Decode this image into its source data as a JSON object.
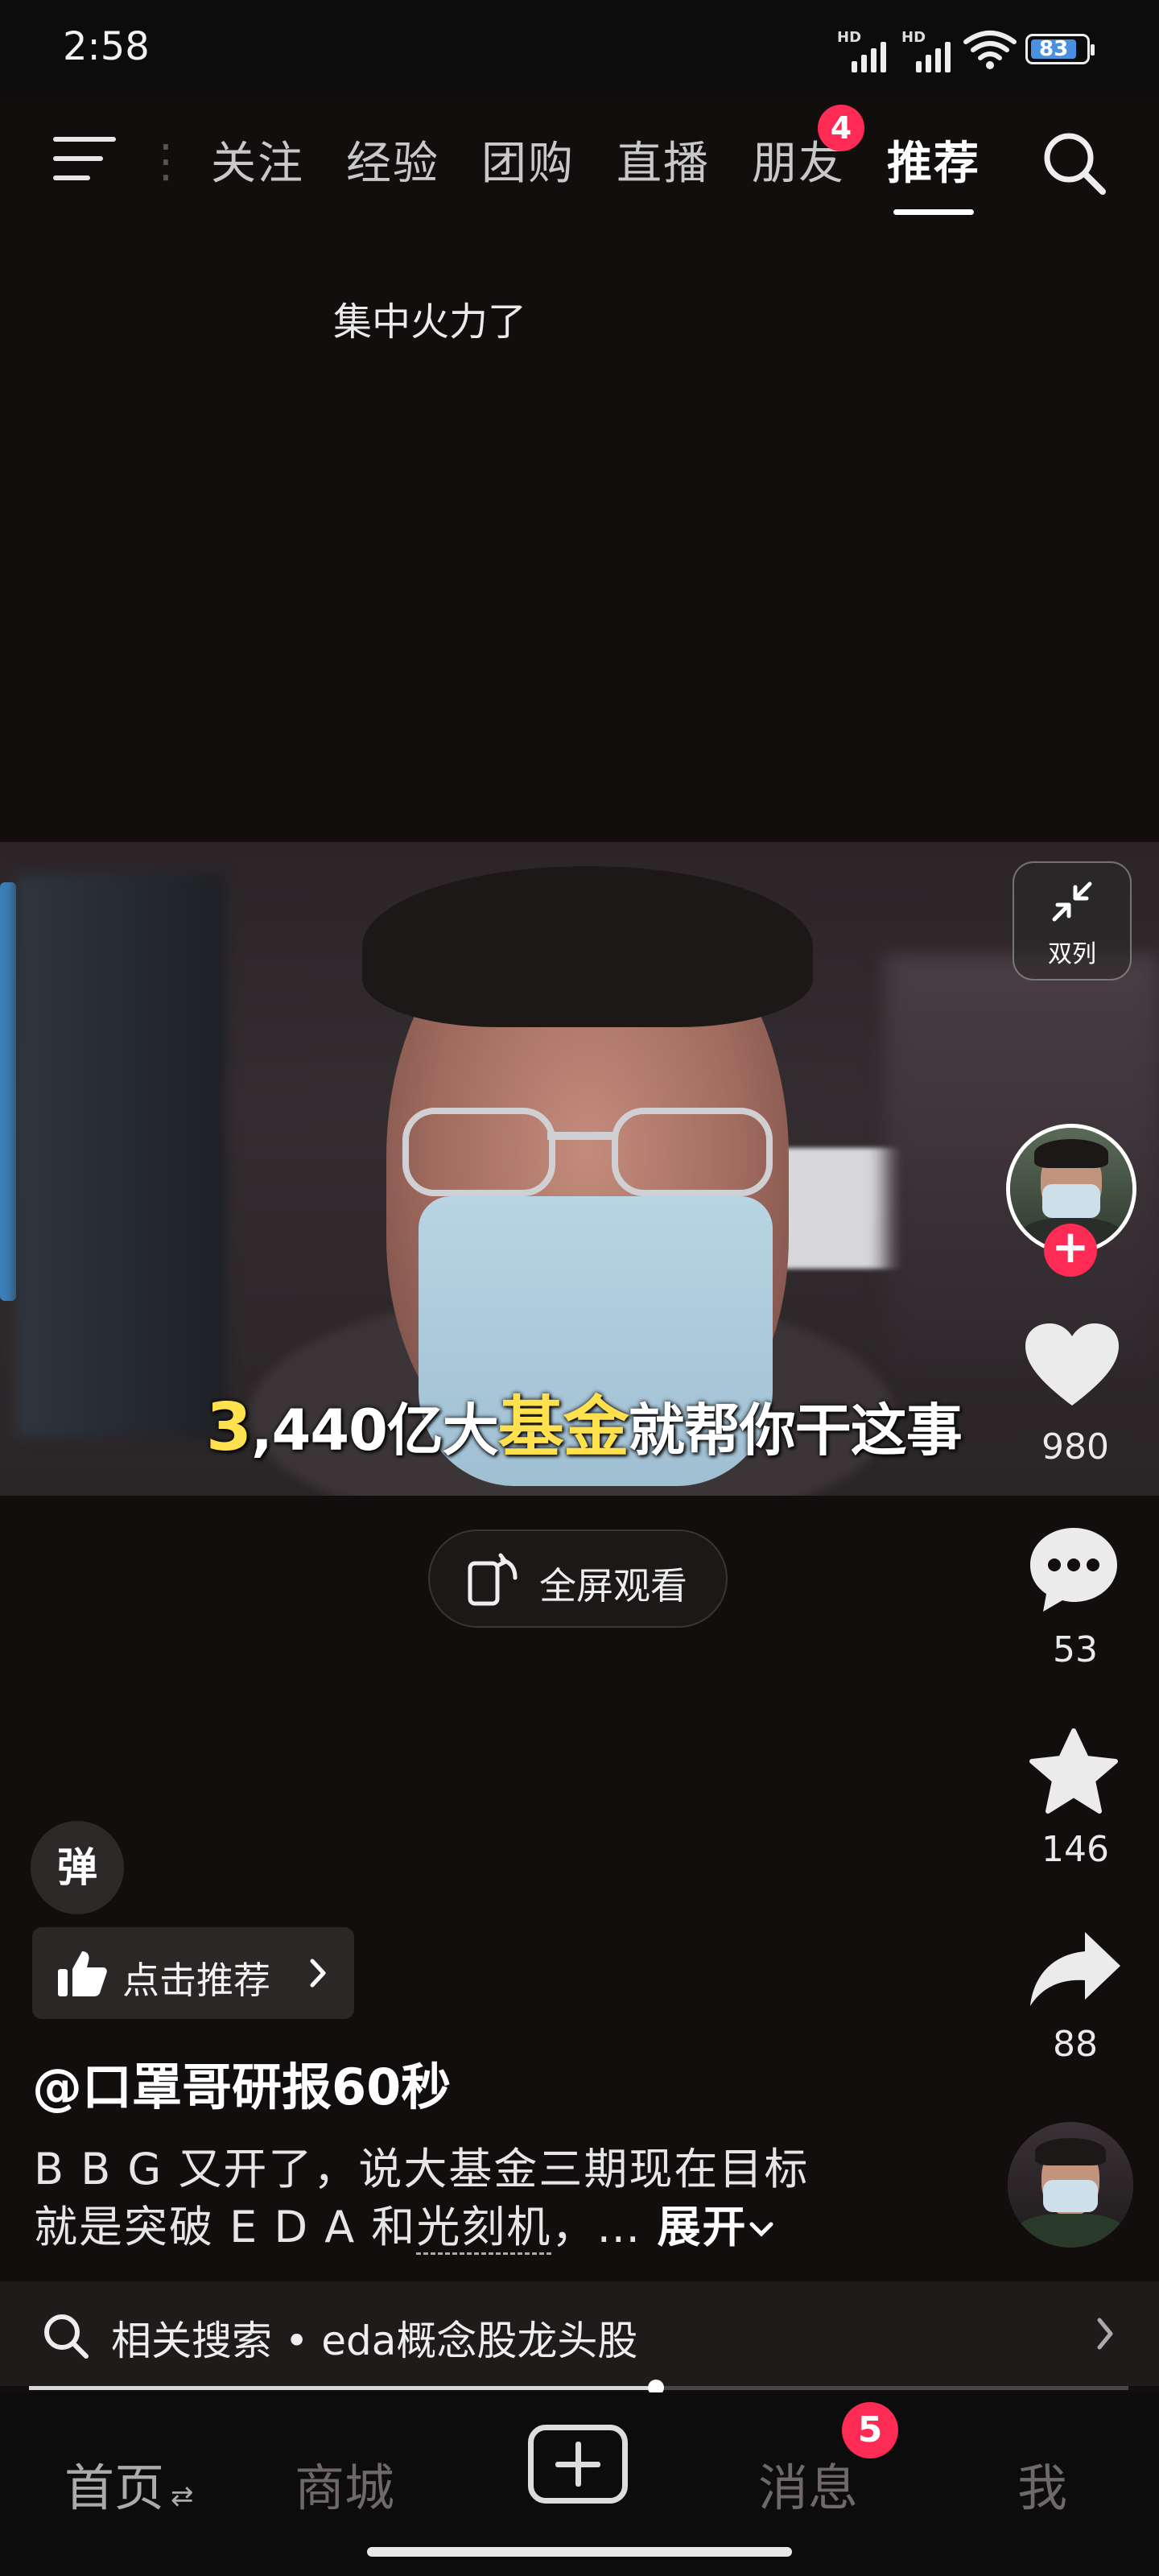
{
  "status_bar": {
    "time": "2:58",
    "battery": "83",
    "signal_label": "HD"
  },
  "top_nav": {
    "tabs": [
      {
        "label": "关注",
        "active": false
      },
      {
        "label": "经验",
        "active": false
      },
      {
        "label": "团购",
        "active": false
      },
      {
        "label": "直播",
        "active": false
      },
      {
        "label": "朋友",
        "active": false
      },
      {
        "label": "推荐",
        "active": true
      }
    ],
    "friends_badge": "4"
  },
  "caption": "集中火力了",
  "video": {
    "subtitle_part1": "3",
    "subtitle_part2": ",440亿大",
    "subtitle_part3": "基金",
    "subtitle_part4": "就帮你干这事",
    "double_column_label": "双列"
  },
  "right_rail": {
    "likes": "980",
    "comments": "53",
    "favorites": "146",
    "shares": "88"
  },
  "fullscreen_label": "全屏观看",
  "danmaku_label": "弹",
  "recommend_label": "点击推荐",
  "author": "@口罩哥研报60秒",
  "description": {
    "line1": "B B G 又开了，说大基金三期现在目标",
    "line2_prefix": "就是突破 E D A 和",
    "line2_link": "光刻机",
    "line2_suffix": "，…",
    "expand": "展开"
  },
  "related_search": "相关搜索 • eda概念股龙头股",
  "progress": 0.57,
  "bottom_nav": {
    "home": "首页",
    "mall": "商城",
    "messages": "消息",
    "me": "我",
    "messages_badge": "5"
  },
  "colors": {
    "accent": "#fe2c55",
    "subtitle_highlight": "#ffe14d",
    "background": "#120e0e"
  }
}
